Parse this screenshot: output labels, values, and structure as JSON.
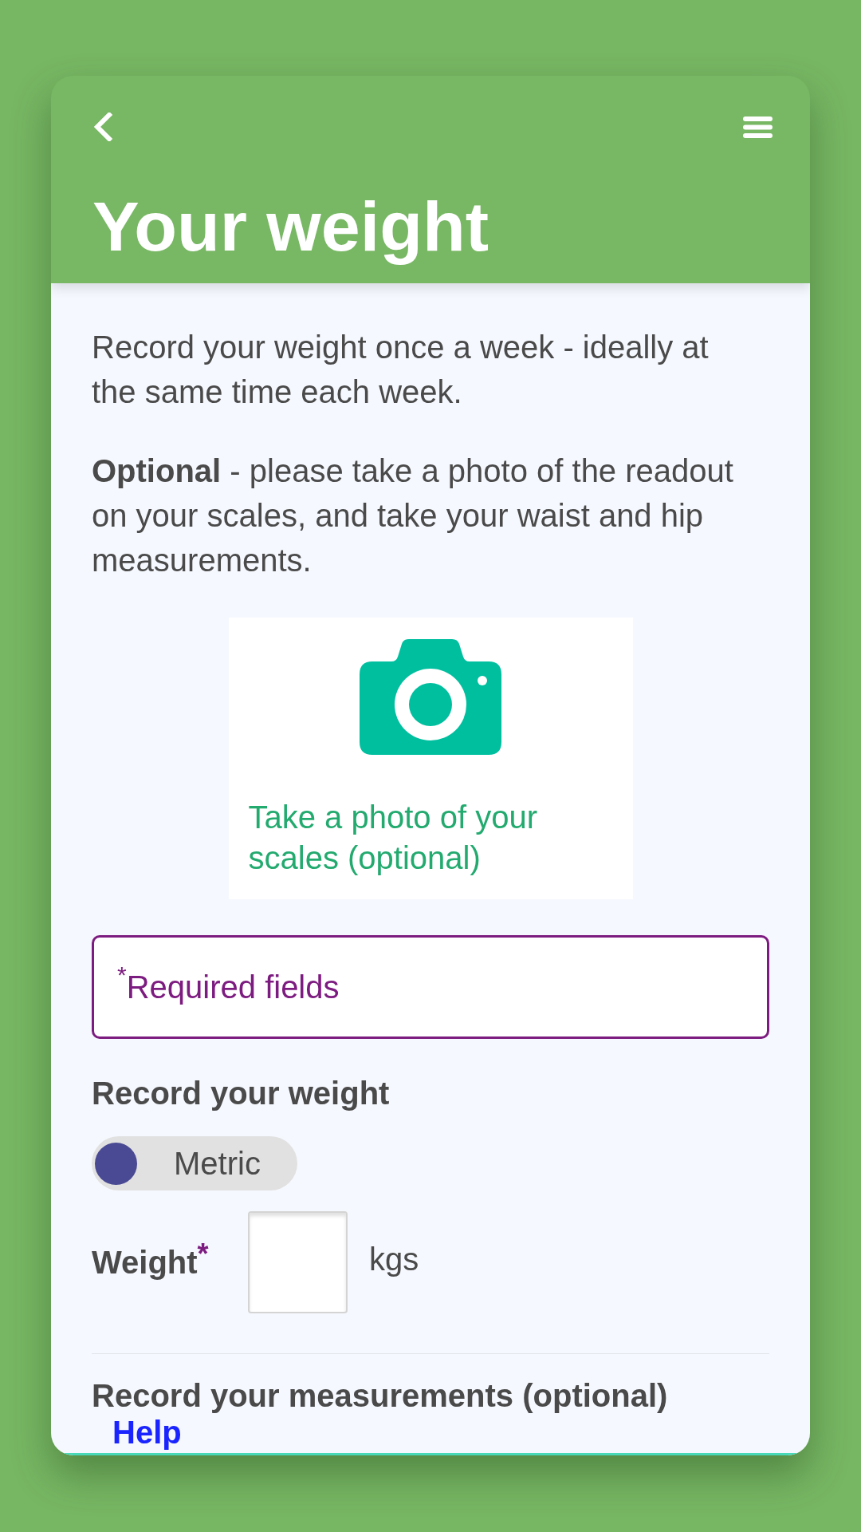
{
  "header": {
    "title": "Your weight"
  },
  "intro": [
    "Record your weight once a week - ideally at the same time each week.",
    "**Optional** - please take a photo of the readout on your scales, and take your waist and hip measurements."
  ],
  "photo_button": {
    "label": "Take a photo of your scales (optional)"
  },
  "required_note": {
    "text": "$^{*}$Required fields"
  },
  "weight_section": {
    "heading": "Record your weight",
    "unit_toggle": {
      "label": "Metric",
      "on": false
    },
    "field": {
      "label": "Weight",
      "required_mark": "*",
      "unit": "kgs"
    }
  },
  "measurements_section": {
    "heading": "Record your measurements (optional)",
    "help_link": "Help"
  }
}
